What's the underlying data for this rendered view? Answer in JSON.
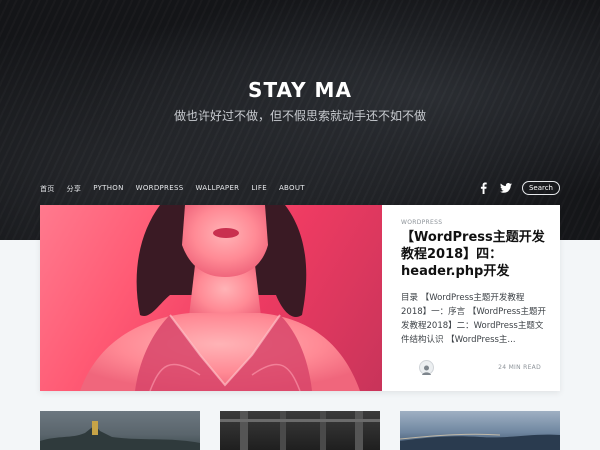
{
  "site": {
    "title": "STAY MA",
    "tagline": "做也许好过不做，但不假思索就动手还不如不做"
  },
  "nav": {
    "items": [
      "首页",
      "分享",
      "PYTHON",
      "WORDPRESS",
      "WALLPAPER",
      "LIFE",
      "ABOUT"
    ],
    "search_label": "Search",
    "social_icons": [
      "facebook-icon",
      "twitter-icon"
    ]
  },
  "featured_post": {
    "category": "WORDPRESS",
    "title": "【WordPress主题开发教程2018】四：header.php开发",
    "excerpt": "目录 【WordPress主题开发教程2018】一：序言 【WordPress主题开发教程2018】二：WordPress主题文件结构认识 【WordPress主...",
    "read_time": "24 MIN READ"
  },
  "colors": {
    "hero_bg": "#141518",
    "page_bg": "#f3f6f8",
    "feature_accent": "#ff5a74"
  }
}
